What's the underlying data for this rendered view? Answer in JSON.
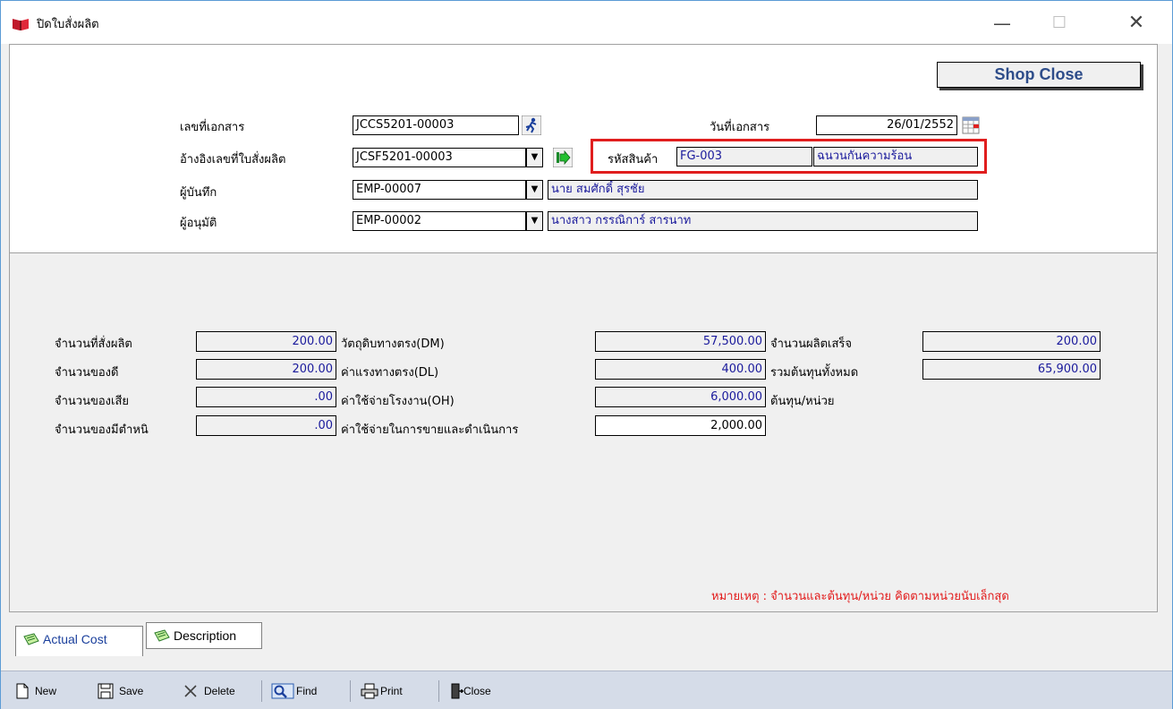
{
  "window": {
    "title": "ปิดใบสั่งผลิต"
  },
  "header": {
    "shop_close_label": "Shop Close",
    "doc_no_label": "เลขที่เอกสาร",
    "doc_no_value": "JCCS5201-00003",
    "ref_no_label": "อ้างอิงเลขที่ใบสั่งผลิต",
    "ref_no_value": "JCSF5201-00003",
    "recorder_label": "ผู้บันทึก",
    "recorder_code": "EMP-00007",
    "recorder_name": "นาย สมศักดิ์ สุรชัย",
    "approver_label": "ผู้อนุมัติ",
    "approver_code": "EMP-00002",
    "approver_name": "นางสาว กรรณิการ์ สารนาท",
    "doc_date_label": "วันที่เอกสาร",
    "doc_date_value": "26/01/2552",
    "product_code_label": "รหัสสินค้า",
    "product_code_value": "FG-003",
    "product_name_value": "ฉนวนกันความร้อน"
  },
  "detail": {
    "qty_ordered_label": "จำนวนที่สั่งผลิต",
    "qty_ordered_value": "200.00",
    "qty_good_label": "จำนวนของดี",
    "qty_good_value": "200.00",
    "qty_bad_label": "จำนวนของเสีย",
    "qty_bad_value": ".00",
    "qty_defect_label": "จำนวนของมีตำหนิ",
    "qty_defect_value": ".00",
    "dm_label": "วัตถุดิบทางตรง(DM)",
    "dm_value": "57,500.00",
    "dl_label": "ค่าแรงทางตรง(DL)",
    "dl_value": "400.00",
    "oh_label": "ค่าใช้จ่ายโรงงาน(OH)",
    "oh_value": "6,000.00",
    "sa_label": "ค่าใช้จ่ายในการขายและดำเนินการ",
    "sa_value": "2,000.00",
    "qty_finished_label": "จำนวนผลิตเสร็จ",
    "qty_finished_value": "200.00",
    "total_cost_label": "รวมต้นทุนทั้งหมด",
    "total_cost_value": "65,900.00",
    "unit_cost_label": "ต้นทุน/หน่วย",
    "note": "หมายเหตุ : จำนวนและต้นทุน/หน่วย คิดตามหน่วยนับเล็กสุด"
  },
  "tabs": [
    {
      "label": "Actual Cost"
    },
    {
      "label": "Description"
    }
  ],
  "toolbar": {
    "new_label": "New",
    "save_label": "Save",
    "delete_label": "Delete",
    "find_label": "Find",
    "print_label": "Print",
    "close_label": "Close"
  },
  "colors": {
    "value_blue": "#1a1a9c",
    "note_red": "#e21b1b",
    "highlight_red": "#e01e1e",
    "shop_close_text": "#2e4d8a",
    "toolbar_bg": "#d5dce8"
  }
}
